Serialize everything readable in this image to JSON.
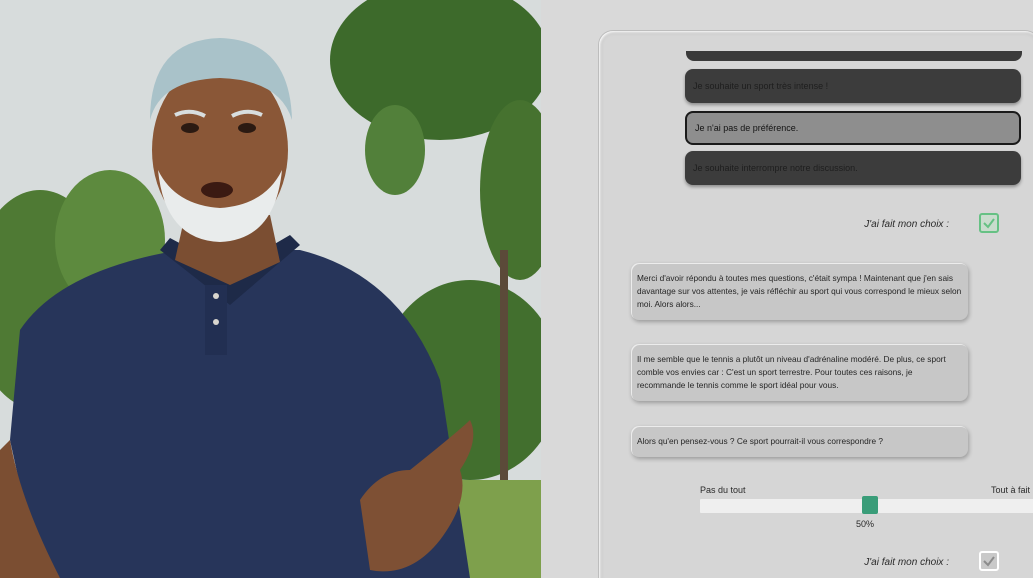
{
  "choices": {
    "intense": "Je souhaite un sport très intense !",
    "no_preference": "Je n'ai pas de préférence.",
    "interrupt": "Je souhaite interrompre notre discussion."
  },
  "confirm": {
    "first_label": "J'ai fait mon choix :",
    "second_label": "J'ai fait mon choix :"
  },
  "messages": [
    "Merci d'avoir répondu à toutes mes questions, c'était sympa ! Maintenant que j'en sais davantage sur vos attentes, je vais réfléchir au sport qui vous correspond le mieux selon moi. Alors alors...",
    "Il me semble que le tennis a plutôt un niveau d'adrénaline modéré. De plus, ce sport comble vos envies car : C'est un sport terrestre. Pour toutes ces raisons, je recommande le tennis comme le sport idéal pour vous.",
    "Alors qu'en pensez-vous ? Ce sport pourrait-il vous correspondre ?"
  ],
  "rating": {
    "min_label": "Pas du tout",
    "max_label": "Tout à fait",
    "value_label": "50%",
    "value": 0.5
  },
  "colors": {
    "accent": "#3a9d79",
    "check_green": "#66c184",
    "shirt": "#27355a",
    "panel_bg": "#d6d6d6"
  }
}
